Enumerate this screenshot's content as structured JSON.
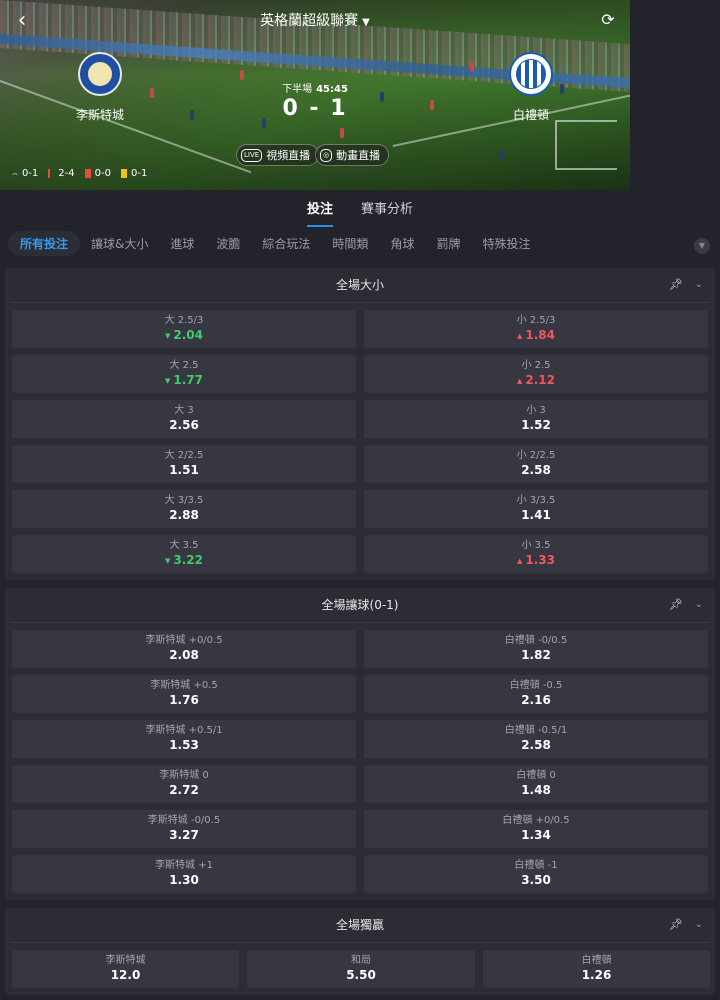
{
  "header": {
    "league": "英格蘭超級聯賽",
    "home_team": "李斯特城",
    "away_team": "白禮頓",
    "period": "下半場",
    "clock": "45:45",
    "score": "0 - 1",
    "video_stream": "視頻直播",
    "animation_stream": "動畫直播",
    "stats": {
      "corners": "0-1",
      "corners_alt": "2-4",
      "red_cards": "0-0",
      "yellow_cards": "0-1"
    }
  },
  "main_tabs": [
    "投注",
    "賽事分析"
  ],
  "category_tabs": [
    "所有投注",
    "讓球&大小",
    "進球",
    "波膽",
    "綜合玩法",
    "時間類",
    "角球",
    "罰牌",
    "特殊投注"
  ],
  "markets": [
    {
      "title": "全場大小",
      "rows": [
        [
          {
            "label": "大 2.5/3",
            "odds": "2.04",
            "trend": "down"
          },
          {
            "label": "小 2.5/3",
            "odds": "1.84",
            "trend": "up"
          }
        ],
        [
          {
            "label": "大 2.5",
            "odds": "1.77",
            "trend": "down"
          },
          {
            "label": "小 2.5",
            "odds": "2.12",
            "trend": "up"
          }
        ],
        [
          {
            "label": "大 3",
            "odds": "2.56",
            "trend": ""
          },
          {
            "label": "小 3",
            "odds": "1.52",
            "trend": ""
          }
        ],
        [
          {
            "label": "大 2/2.5",
            "odds": "1.51",
            "trend": ""
          },
          {
            "label": "小 2/2.5",
            "odds": "2.58",
            "trend": ""
          }
        ],
        [
          {
            "label": "大 3/3.5",
            "odds": "2.88",
            "trend": ""
          },
          {
            "label": "小 3/3.5",
            "odds": "1.41",
            "trend": ""
          }
        ],
        [
          {
            "label": "大 3.5",
            "odds": "3.22",
            "trend": "down"
          },
          {
            "label": "小 3.5",
            "odds": "1.33",
            "trend": "up"
          }
        ]
      ]
    },
    {
      "title": "全場讓球(0-1)",
      "rows": [
        [
          {
            "label": "李斯特城 +0/0.5",
            "odds": "2.08",
            "trend": ""
          },
          {
            "label": "白禮頓 -0/0.5",
            "odds": "1.82",
            "trend": ""
          }
        ],
        [
          {
            "label": "李斯特城 +0.5",
            "odds": "1.76",
            "trend": ""
          },
          {
            "label": "白禮頓 -0.5",
            "odds": "2.16",
            "trend": ""
          }
        ],
        [
          {
            "label": "李斯特城 +0.5/1",
            "odds": "1.53",
            "trend": ""
          },
          {
            "label": "白禮頓 -0.5/1",
            "odds": "2.58",
            "trend": ""
          }
        ],
        [
          {
            "label": "李斯特城 0",
            "odds": "2.72",
            "trend": ""
          },
          {
            "label": "白禮頓 0",
            "odds": "1.48",
            "trend": ""
          }
        ],
        [
          {
            "label": "李斯特城 -0/0.5",
            "odds": "3.27",
            "trend": ""
          },
          {
            "label": "白禮頓 +0/0.5",
            "odds": "1.34",
            "trend": ""
          }
        ],
        [
          {
            "label": "李斯特城 +1",
            "odds": "1.30",
            "trend": ""
          },
          {
            "label": "白禮頓 -1",
            "odds": "3.50",
            "trend": ""
          }
        ]
      ]
    },
    {
      "title": "全場獨贏",
      "rows": [
        [
          {
            "label": "李斯特城",
            "odds": "12.0",
            "trend": ""
          },
          {
            "label": "和局",
            "odds": "5.50",
            "trend": ""
          },
          {
            "label": "白禮頓",
            "odds": "1.26",
            "trend": ""
          }
        ]
      ]
    }
  ],
  "colors": {
    "accent": "#2f8fe8",
    "odds_down": "#3fcb6c",
    "odds_up": "#f2565e",
    "background": "#23242b",
    "panel": "#2b2c34",
    "cell": "#363740"
  },
  "icons": {
    "back": "chevron-left-icon",
    "dropdown": "caret-down-icon",
    "refresh": "refresh-icon",
    "pin": "pin-icon",
    "collapse": "chevron-down-icon"
  }
}
